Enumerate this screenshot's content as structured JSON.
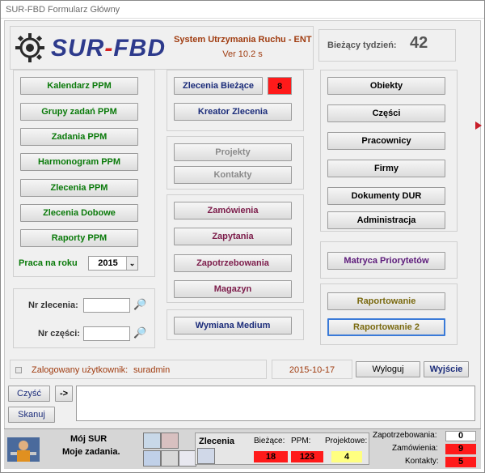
{
  "window": {
    "title": "SUR-FBD Formularz Główny"
  },
  "header": {
    "logo_text": "SUR-FBD",
    "system_name": "System Utrzymania Ruchu - ENT",
    "version": "Ver 10.2 s",
    "week_label": "Bieżący tydzień:",
    "week_value": "42"
  },
  "ppm": {
    "buttons": [
      "Kalendarz PPM",
      "Grupy zadań PPM",
      "Zadania PPM",
      "Harmonogram PPM",
      "Zlecenia PPM",
      "Zlecenia Dobowe",
      "Raporty PPM"
    ],
    "year_label": "Praca na roku",
    "year_value": "2015"
  },
  "search": {
    "order_label": "Nr zlecenia:",
    "part_label": "Nr części:"
  },
  "orders": {
    "current_label": "Zlecenia Bieżące",
    "current_count": "8",
    "wizard_label": "Kreator Zlecenia"
  },
  "projects": {
    "projects_label": "Projekty",
    "contacts_label": "Kontakty"
  },
  "purchasing": [
    "Zamówienia",
    "Zapytania",
    "Zapotrzebowania",
    "Magazyn"
  ],
  "medium": {
    "label": "Wymiana Medium"
  },
  "right": {
    "buttons": [
      "Obiekty",
      "Części",
      "Pracownicy",
      "Firmy",
      "Dokumenty DUR",
      "Administracja"
    ],
    "matrix_label": "Matryca Priorytetów",
    "report_label": "Raportowanie",
    "report2_label": "Raportowanie 2"
  },
  "status": {
    "user_label": "Zalogowany użytkownik:",
    "user_value": "suradmin",
    "date": "2015-10-17",
    "logout_label": "Wyloguj",
    "exit_label": "Wyjście"
  },
  "notes": {
    "clear_label": "Czyść",
    "arrow_label": "->",
    "scan_label": "Skanuj"
  },
  "bottom": {
    "mysur_title": "Mój SUR",
    "mysur_subtitle": "Moje zadania.",
    "orders_title": "Zlecenia",
    "current_label": "Bieżące:",
    "current_value": "18",
    "ppm_label": "PPM:",
    "ppm_value": "123",
    "project_label": "Projektowe:",
    "project_value": "4",
    "req_label": "Zapotrzebowania:",
    "req_value": "0",
    "orders_label": "Zamówienia:",
    "orders_value": "9",
    "contacts_label": "Kontakty:",
    "contacts_value": "5"
  },
  "colors": {
    "accent_red": "#ff1a1a",
    "logo_blue": "#2d3a8c",
    "logo_red": "#d42020",
    "system_text": "#a03c10"
  }
}
